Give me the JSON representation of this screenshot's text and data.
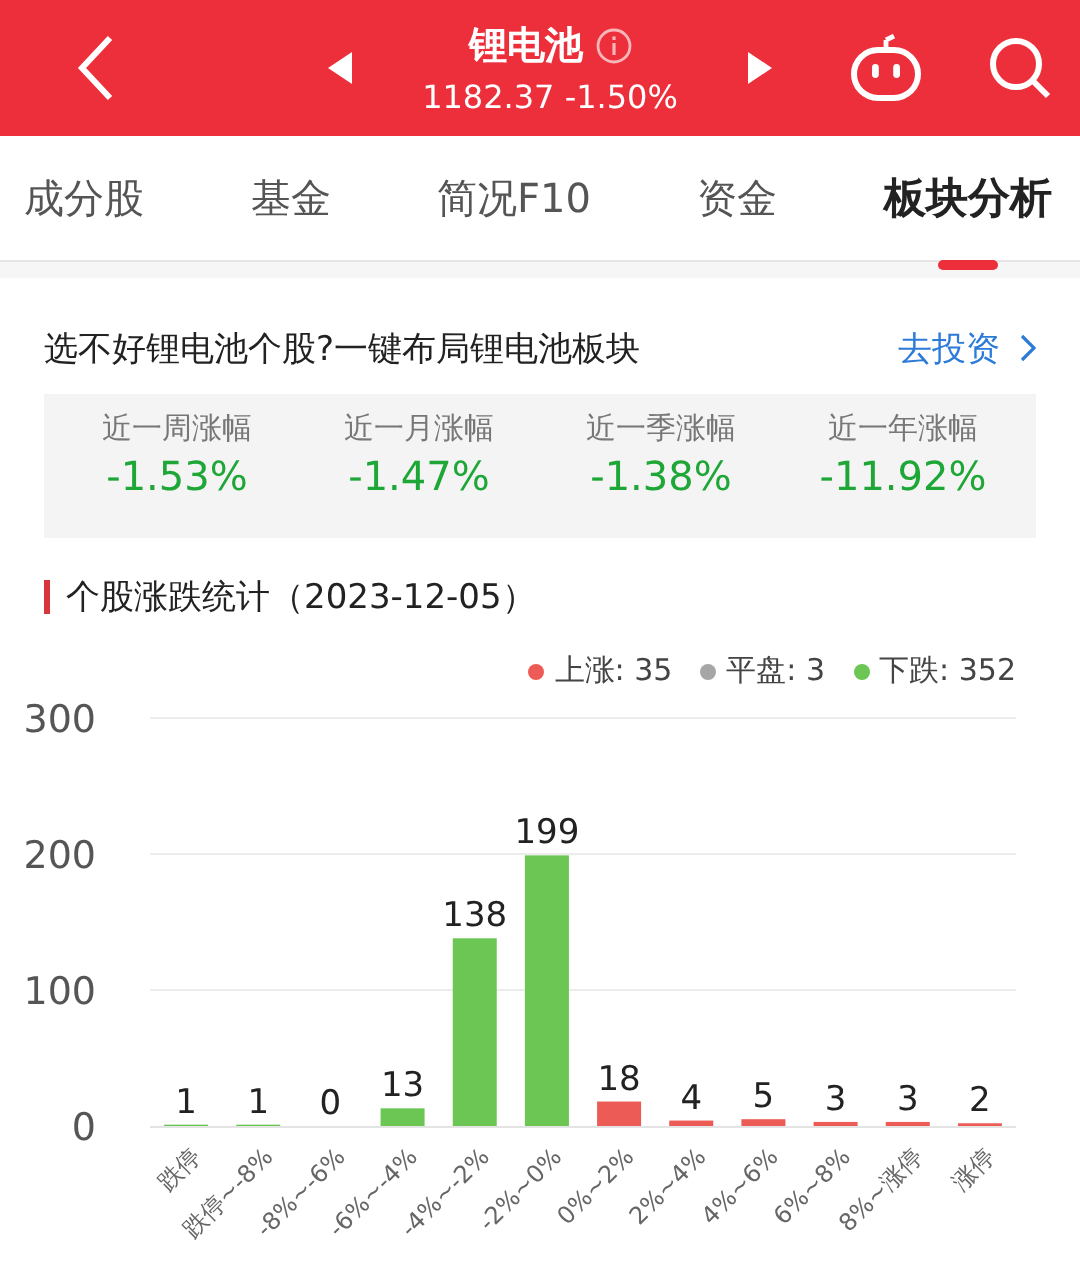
{
  "header": {
    "title": "锂电池",
    "quote": "1182.37 -1.50%"
  },
  "tabs": [
    {
      "label": "成分股",
      "selected": false
    },
    {
      "label": "基金",
      "selected": false
    },
    {
      "label": "简况F10",
      "selected": false
    },
    {
      "label": "资金",
      "selected": false
    },
    {
      "label": "板块分析",
      "selected": true
    }
  ],
  "promo": {
    "text": "选不好锂电池个股?一键布局锂电池板块",
    "link": "去投资"
  },
  "stats": [
    {
      "label": "近一周涨幅",
      "value": "-1.53%"
    },
    {
      "label": "近一月涨幅",
      "value": "-1.47%"
    },
    {
      "label": "近一季涨幅",
      "value": "-1.38%"
    },
    {
      "label": "近一年涨幅",
      "value": "-11.92%"
    }
  ],
  "section": {
    "title": "个股涨跌统计（2023-12-05）",
    "legend": [
      {
        "label": "上涨: 35",
        "color": "#ec5b56"
      },
      {
        "label": "平盘: 3",
        "color": "#a6a6a6"
      },
      {
        "label": "下跌: 352",
        "color": "#6cc653"
      }
    ],
    "chart_data": {
      "type": "bar",
      "categories": [
        "跌停",
        "跌停~-8%",
        "-8%~-6%",
        "-6%~-4%",
        "-4%~-2%",
        "-2%~0%",
        "0%~2%",
        "2%~4%",
        "4%~6%",
        "6%~8%",
        "8%~涨停",
        "涨停"
      ],
      "series": [
        {
          "color": "#6cc653",
          "values": [
            1,
            1,
            0,
            13,
            138,
            199,
            null,
            null,
            null,
            null,
            null,
            null
          ]
        },
        {
          "color": "#ec5b56",
          "values": [
            null,
            null,
            null,
            null,
            null,
            null,
            18,
            4,
            5,
            3,
            3,
            2
          ]
        }
      ],
      "ylim": [
        0,
        300
      ],
      "yticks": [
        0,
        100,
        200,
        300
      ],
      "data_labels": true
    }
  }
}
